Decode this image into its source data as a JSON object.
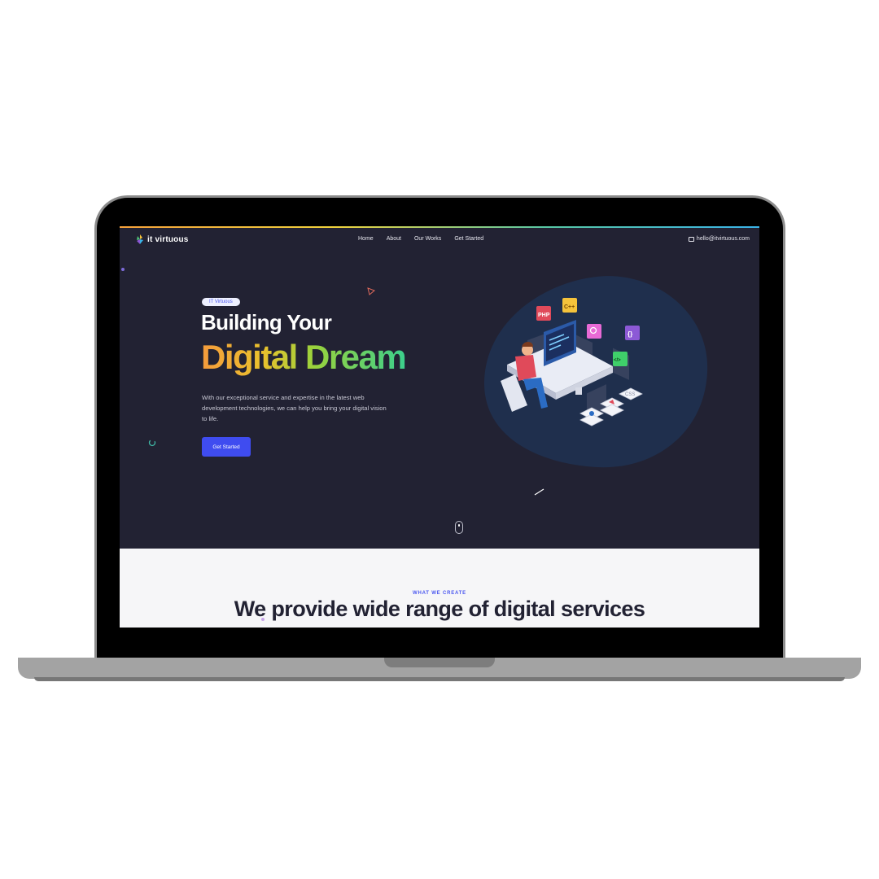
{
  "brand": {
    "name": "it virtuous"
  },
  "nav": {
    "items": [
      "Home",
      "About",
      "Our Works",
      "Get Started"
    ],
    "email": "hello@itvirtuous.com"
  },
  "hero": {
    "badge": "IT Virtuous",
    "title_line1": "Building Your",
    "title_line2": "Digital Dream",
    "description": "With our exceptional service and expertise in the latest web development technologies, we can help you bring your digital vision to life.",
    "cta": "Get Started"
  },
  "illustration": {
    "tiles": [
      "PHP",
      "C++",
      "{}",
      "</>",
      "CSS"
    ]
  },
  "section2": {
    "eyebrow": "WHAT WE CREATE",
    "title": "We provide wide range of digital services"
  },
  "colors": {
    "accent": "#3f4cf0",
    "dark_bg": "#222233",
    "blob": "#1f2f4d"
  }
}
